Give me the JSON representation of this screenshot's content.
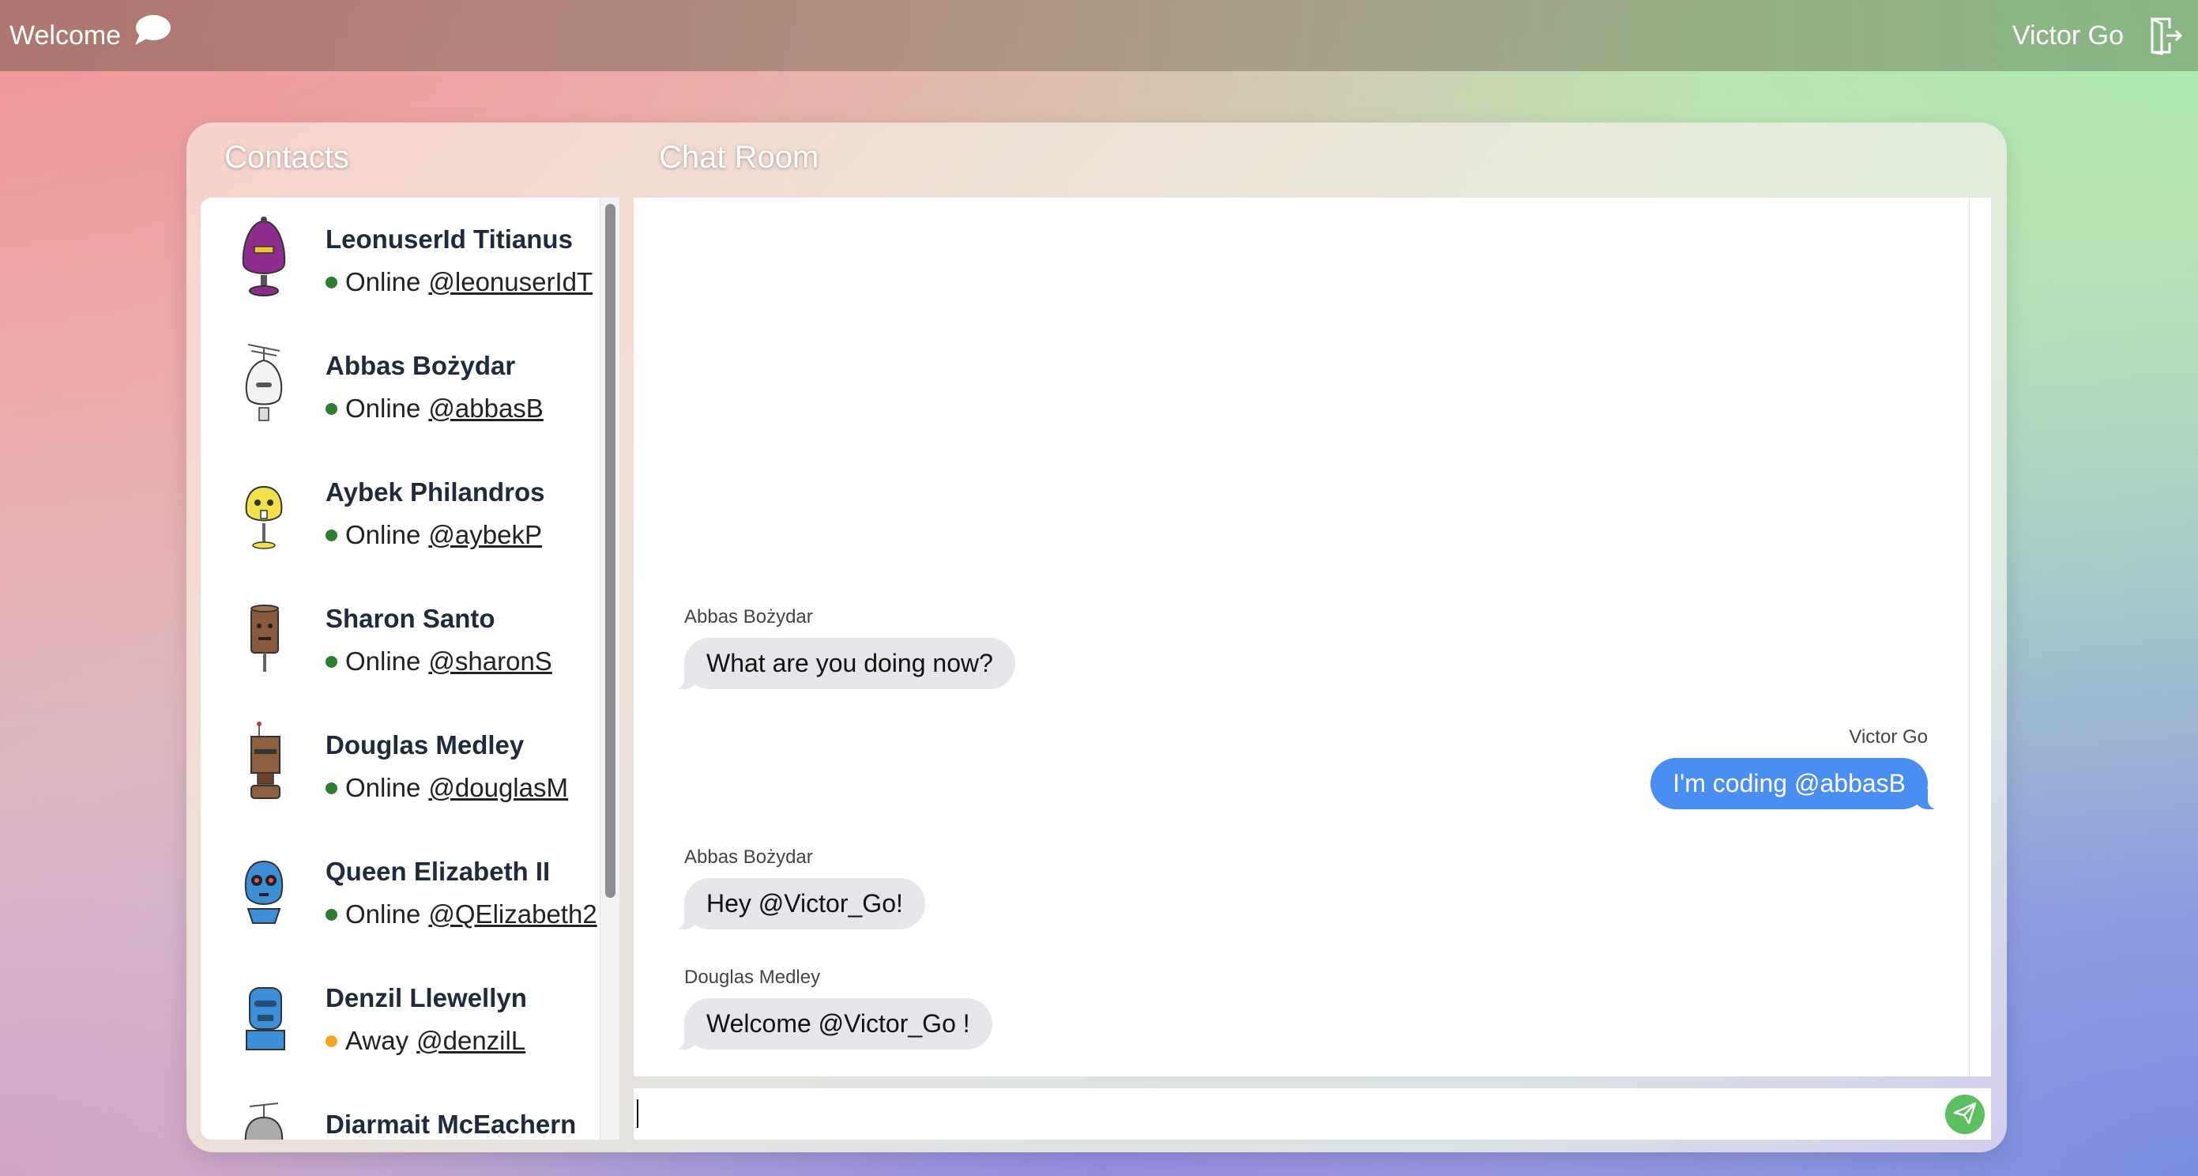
{
  "topbar": {
    "welcome_label": "Welcome",
    "user_name": "Victor Go"
  },
  "contacts": {
    "title": "Contacts",
    "items": [
      {
        "name": "LeonuserId Titianus",
        "status": "Online",
        "handle": "@leonuserIdT",
        "status_color": "#2e7d32",
        "avatar_color": "#8e2c8e"
      },
      {
        "name": "Abbas Bożydar",
        "status": "Online",
        "handle": "@abbasB",
        "status_color": "#2e7d32",
        "avatar_color": "#eeeeee"
      },
      {
        "name": "Aybek Philandros",
        "status": "Online",
        "handle": "@aybekP",
        "status_color": "#2e7d32",
        "avatar_color": "#f2e14c"
      },
      {
        "name": "Sharon Santo",
        "status": "Online",
        "handle": "@sharonS",
        "status_color": "#2e7d32",
        "avatar_color": "#8a5a3c"
      },
      {
        "name": "Douglas Medley",
        "status": "Online",
        "handle": "@douglasM",
        "status_color": "#2e7d32",
        "avatar_color": "#8c5f3e"
      },
      {
        "name": "Queen Elizabeth II",
        "status": "Online",
        "handle": "@QElizabeth2",
        "status_color": "#2e7d32",
        "avatar_color": "#3d8ed6"
      },
      {
        "name": "Denzil Llewellyn",
        "status": "Away",
        "handle": "@denzilL",
        "status_color": "#f5a623",
        "avatar_color": "#3d8ed6"
      },
      {
        "name": "Diarmait McEachern",
        "status": "",
        "handle": "",
        "status_color": "#2e7d32",
        "avatar_color": "#aaaaaa"
      }
    ]
  },
  "chat": {
    "title": "Chat Room",
    "messages": [
      {
        "author": "Abbas Bożydar",
        "text": "What are you doing now?",
        "direction": "in"
      },
      {
        "author": "Victor Go",
        "text": "I'm coding @abbasB",
        "direction": "out"
      },
      {
        "author": "Abbas Bożydar",
        "text": "Hey @Victor_Go!",
        "direction": "in"
      },
      {
        "author": "Douglas Medley",
        "text": "Welcome @Victor_Go !",
        "direction": "in"
      }
    ],
    "input_value": ""
  },
  "colors": {
    "outgoing_bubble": "#4a8ef2",
    "incoming_bubble": "#e5e5ea",
    "send_button": "#5cbf60",
    "online": "#2e7d32",
    "away": "#f5a623"
  }
}
